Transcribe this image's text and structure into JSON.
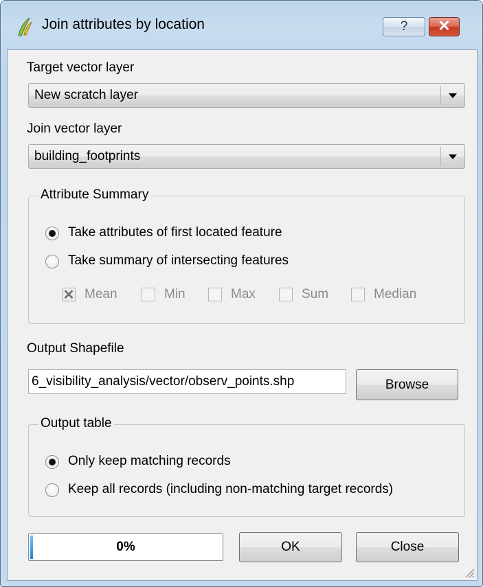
{
  "window": {
    "title": "Join attributes by location",
    "help_label": "?",
    "close_label": "✕"
  },
  "target_layer": {
    "label": "Target vector layer",
    "value": "New scratch layer"
  },
  "join_layer": {
    "label": "Join vector layer",
    "value": "building_footprints"
  },
  "attribute_summary": {
    "title": "Attribute Summary",
    "options": [
      {
        "label": "Take attributes of first located feature",
        "checked": true
      },
      {
        "label": "Take summary of intersecting features",
        "checked": false
      }
    ],
    "stats": [
      {
        "label": "Mean",
        "checked": true
      },
      {
        "label": "Min",
        "checked": false
      },
      {
        "label": "Max",
        "checked": false
      },
      {
        "label": "Sum",
        "checked": false
      },
      {
        "label": "Median",
        "checked": false
      }
    ]
  },
  "output_shapefile": {
    "label": "Output Shapefile",
    "value": "6_visibility_analysis/vector/observ_points.shp",
    "browse_label": "Browse"
  },
  "output_table": {
    "title": "Output table",
    "options": [
      {
        "label": "Only keep matching records",
        "checked": true
      },
      {
        "label": "Keep all records (including non-matching target records)",
        "checked": false
      }
    ]
  },
  "footer": {
    "progress_text": "0%",
    "progress_value": 0,
    "ok_label": "OK",
    "close_label": "Close"
  },
  "colors": {
    "titlebar": "#c4daef",
    "client": "#f0f0f0",
    "progress": "#1c84d8",
    "close_button": "#c4391f"
  },
  "icons": {
    "app": "qgis-logo-icon",
    "resize": "resize-grip-icon"
  }
}
